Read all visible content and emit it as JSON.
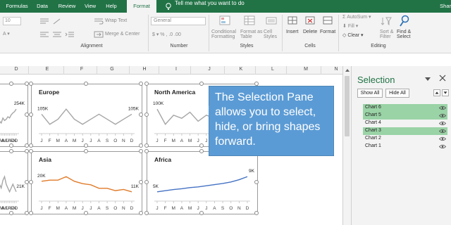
{
  "menu": {
    "tabs": [
      "Formulas",
      "Data",
      "Review",
      "View",
      "Help",
      "Format"
    ],
    "active_tab": "Format",
    "tell_me": "Tell me what you want to do",
    "share": "Shar"
  },
  "ribbon": {
    "font_size_value": "10",
    "wrap_text": "Wrap Text",
    "merge_center": "Merge & Center",
    "number_format": "General",
    "conditional_formatting": [
      "Conditional",
      "Formatting"
    ],
    "format_as_table": [
      "Format as",
      "Table"
    ],
    "cell_styles": [
      "Cell",
      "Styles"
    ],
    "insert": "Insert",
    "delete": "Delete",
    "format": "Format",
    "autosum": "AutoSum",
    "fill": "Fill",
    "clear": "Clear",
    "sort_filter": [
      "Sort &",
      "Filter"
    ],
    "find_select": [
      "Find &",
      "Select"
    ],
    "groups": [
      "Alignment",
      "Number",
      "Styles",
      "Cells",
      "Editing"
    ]
  },
  "columns": [
    "D",
    "E",
    "F",
    "G",
    "H",
    "I",
    "J",
    "K",
    "L",
    "M",
    "N"
  ],
  "months": [
    "J",
    "F",
    "M",
    "A",
    "M",
    "J",
    "J",
    "A",
    "S",
    "O",
    "N",
    "D"
  ],
  "charts": [
    {
      "title": "",
      "start_label": "",
      "end_label": "254K",
      "color": "#a6a6a6"
    },
    {
      "title": "Europe",
      "start_label": "105K",
      "end_label": "105K",
      "color": "#a6a6a6"
    },
    {
      "title": "North America",
      "start_label": "100K",
      "end_label": "",
      "color": "#a6a6a6"
    },
    {
      "title": "",
      "start_label": "",
      "end_label": "21K",
      "color": "#a6a6a6"
    },
    {
      "title": "Asia",
      "start_label": "20K",
      "end_label": "11K",
      "color": "#e07b2a"
    },
    {
      "title": "Africa",
      "start_label": "5K",
      "end_label": "9K",
      "color": "#4472c4"
    }
  ],
  "chart_data": [
    {
      "type": "line",
      "title": "Europe",
      "x": [
        "J",
        "F",
        "M",
        "A",
        "M",
        "J",
        "J",
        "A",
        "S",
        "O",
        "N",
        "D"
      ],
      "series": [
        {
          "values": [
            105,
            103,
            104,
            106,
            104,
            103,
            104,
            105,
            104,
            103,
            104,
            105
          ]
        }
      ]
    },
    {
      "type": "line",
      "title": "North America",
      "x": [
        "J",
        "F",
        "M",
        "A",
        "M",
        "J",
        "J",
        "A",
        "S",
        "O",
        "N",
        "D"
      ],
      "series": [
        {
          "values": [
            100,
            95,
            98,
            97,
            99,
            96,
            98,
            97,
            95,
            96,
            97,
            98
          ]
        }
      ]
    },
    {
      "type": "line",
      "title": "Asia",
      "x": [
        "J",
        "F",
        "M",
        "A",
        "M",
        "J",
        "J",
        "A",
        "S",
        "O",
        "N",
        "D"
      ],
      "series": [
        {
          "values": [
            20,
            21,
            21,
            24,
            20,
            18,
            17,
            14,
            14,
            12,
            13,
            11
          ]
        }
      ]
    },
    {
      "type": "line",
      "title": "Africa",
      "x": [
        "J",
        "F",
        "M",
        "A",
        "M",
        "J",
        "J",
        "A",
        "S",
        "O",
        "N",
        "D"
      ],
      "series": [
        {
          "values": [
            5,
            5.3,
            5.6,
            5.8,
            6.1,
            6.3,
            6.6,
            6.9,
            7.2,
            7.6,
            8.2,
            9
          ]
        }
      ]
    },
    {
      "type": "line",
      "title": "",
      "x": [
        "J",
        "F",
        "M",
        "A",
        "M",
        "J",
        "J",
        "A",
        "S",
        "O",
        "N",
        "D"
      ],
      "series": [
        {
          "values": [
            230,
            235,
            232,
            240,
            236,
            238,
            242,
            240,
            245,
            248,
            250,
            254
          ]
        }
      ]
    },
    {
      "type": "line",
      "title": "",
      "x": [
        "J",
        "F",
        "M",
        "A",
        "M",
        "J",
        "J",
        "A",
        "S",
        "O",
        "N",
        "D"
      ],
      "series": [
        {
          "values": [
            24,
            23,
            22,
            24,
            25,
            23,
            22,
            21,
            22,
            23,
            22,
            21
          ]
        }
      ]
    }
  ],
  "callout": {
    "text": "The Selection Pane allows you to select, hide, or bring shapes forward.",
    "color": "#5b9bd5"
  },
  "selection_pane": {
    "title": "Selection",
    "show_all": "Show All",
    "hide_all": "Hide All",
    "items": [
      {
        "label": "Chart 6",
        "selected": true
      },
      {
        "label": "Chart 5",
        "selected": true
      },
      {
        "label": "Chart 4",
        "selected": false
      },
      {
        "label": "Chart 3",
        "selected": true
      },
      {
        "label": "Chart 2",
        "selected": false
      },
      {
        "label": "Chart 1",
        "selected": false
      }
    ]
  }
}
